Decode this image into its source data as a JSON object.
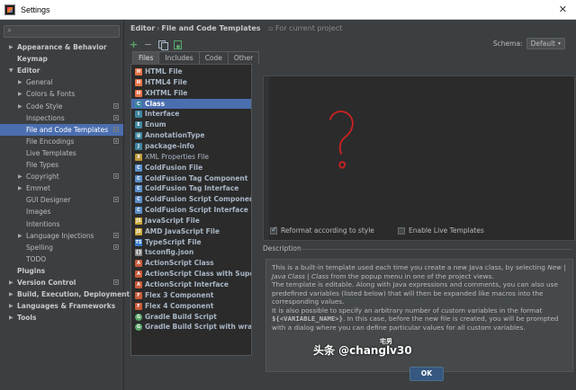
{
  "window": {
    "title": "Settings",
    "close_glyph": "✕"
  },
  "sidebar": {
    "search_placeholder": "",
    "items": [
      {
        "label": "Appearance & Behavior",
        "level": 0,
        "bold": true,
        "arrow": "▶",
        "project": false,
        "selected": false
      },
      {
        "label": "Keymap",
        "level": 0,
        "bold": true,
        "arrow": "",
        "project": false,
        "selected": false
      },
      {
        "label": "Editor",
        "level": 0,
        "bold": true,
        "arrow": "▼",
        "project": false,
        "selected": false
      },
      {
        "label": "General",
        "level": 1,
        "bold": false,
        "arrow": "▶",
        "project": false,
        "selected": false
      },
      {
        "label": "Colors & Fonts",
        "level": 1,
        "bold": false,
        "arrow": "▶",
        "project": false,
        "selected": false
      },
      {
        "label": "Code Style",
        "level": 1,
        "bold": false,
        "arrow": "▶",
        "project": true,
        "selected": false
      },
      {
        "label": "Inspections",
        "level": 1,
        "bold": false,
        "arrow": "",
        "project": true,
        "selected": false
      },
      {
        "label": "File and Code Templates",
        "level": 1,
        "bold": false,
        "arrow": "",
        "project": true,
        "selected": true
      },
      {
        "label": "File Encodings",
        "level": 1,
        "bold": false,
        "arrow": "",
        "project": true,
        "selected": false
      },
      {
        "label": "Live Templates",
        "level": 1,
        "bold": false,
        "arrow": "",
        "project": false,
        "selected": false
      },
      {
        "label": "File Types",
        "level": 1,
        "bold": false,
        "arrow": "",
        "project": false,
        "selected": false
      },
      {
        "label": "Copyright",
        "level": 1,
        "bold": false,
        "arrow": "▶",
        "project": true,
        "selected": false
      },
      {
        "label": "Emmet",
        "level": 1,
        "bold": false,
        "arrow": "▶",
        "project": false,
        "selected": false
      },
      {
        "label": "GUI Designer",
        "level": 1,
        "bold": false,
        "arrow": "",
        "project": true,
        "selected": false
      },
      {
        "label": "Images",
        "level": 1,
        "bold": false,
        "arrow": "",
        "project": false,
        "selected": false
      },
      {
        "label": "Intentions",
        "level": 1,
        "bold": false,
        "arrow": "",
        "project": false,
        "selected": false
      },
      {
        "label": "Language Injections",
        "level": 1,
        "bold": false,
        "arrow": "▶",
        "project": true,
        "selected": false
      },
      {
        "label": "Spelling",
        "level": 1,
        "bold": false,
        "arrow": "",
        "project": true,
        "selected": false
      },
      {
        "label": "TODO",
        "level": 1,
        "bold": false,
        "arrow": "",
        "project": false,
        "selected": false
      },
      {
        "label": "Plugins",
        "level": 0,
        "bold": true,
        "arrow": "",
        "project": false,
        "selected": false
      },
      {
        "label": "Version Control",
        "level": 0,
        "bold": true,
        "arrow": "▶",
        "project": true,
        "selected": false
      },
      {
        "label": "Build, Execution, Deployment",
        "level": 0,
        "bold": true,
        "arrow": "▶",
        "project": false,
        "selected": false
      },
      {
        "label": "Languages & Frameworks",
        "level": 0,
        "bold": true,
        "arrow": "▶",
        "project": false,
        "selected": false
      },
      {
        "label": "Tools",
        "level": 0,
        "bold": true,
        "arrow": "▶",
        "project": false,
        "selected": false
      }
    ]
  },
  "header": {
    "crumb_1": "Editor",
    "separator": "›",
    "crumb_2": "File and Code Templates",
    "scope_note": "For current project"
  },
  "toolbar": {
    "add": "+",
    "remove": "−"
  },
  "schema": {
    "label": "Schema:",
    "value": "Default",
    "chevron": "▾"
  },
  "tabs": [
    {
      "label": "Files",
      "active": true
    },
    {
      "label": "Includes",
      "active": false
    },
    {
      "label": "Code",
      "active": false
    },
    {
      "label": "Other",
      "active": false
    }
  ],
  "templates": [
    {
      "name": "HTML File",
      "icon": "html",
      "color": "#e8754a",
      "bold": true
    },
    {
      "name": "HTML4 File",
      "icon": "html",
      "color": "#e8754a",
      "bold": true
    },
    {
      "name": "XHTML File",
      "icon": "html",
      "color": "#e8754a",
      "bold": true
    },
    {
      "name": "Class",
      "icon": "class",
      "color": "#3e86a0",
      "bold": true,
      "selected": true
    },
    {
      "name": "Interface",
      "icon": "interface",
      "color": "#3e86a0",
      "bold": true
    },
    {
      "name": "Enum",
      "icon": "enum",
      "color": "#3e86a0",
      "bold": true
    },
    {
      "name": "AnnotationType",
      "icon": "annotation",
      "color": "#3e86a0",
      "bold": true
    },
    {
      "name": "package-info",
      "icon": "java",
      "color": "#3e86a0",
      "bold": true
    },
    {
      "name": "XML Properties File",
      "icon": "xml",
      "color": "#c09a3a",
      "bold": false
    },
    {
      "name": "ColdFusion File",
      "icon": "cf",
      "color": "#5c8fc9",
      "bold": true
    },
    {
      "name": "ColdFusion Tag Component",
      "icon": "cf",
      "color": "#5c8fc9",
      "bold": true
    },
    {
      "name": "ColdFusion Tag Interface",
      "icon": "cf",
      "color": "#5c8fc9",
      "bold": true
    },
    {
      "name": "ColdFusion Script Component",
      "icon": "cf",
      "color": "#5c8fc9",
      "bold": true
    },
    {
      "name": "ColdFusion Script Interface",
      "icon": "cf",
      "color": "#5c8fc9",
      "bold": true
    },
    {
      "name": "JavaScript File",
      "icon": "js",
      "color": "#c9a83a",
      "bold": true
    },
    {
      "name": "AMD JavaScript File",
      "icon": "js",
      "color": "#c9a83a",
      "bold": true
    },
    {
      "name": "TypeScript File",
      "icon": "ts",
      "color": "#3a7bc9",
      "bold": true
    },
    {
      "name": "tsconfig.json",
      "icon": "json",
      "color": "#8a8a8a",
      "bold": true
    },
    {
      "name": "ActionScript Class",
      "icon": "as",
      "color": "#c95a3a",
      "bold": true
    },
    {
      "name": "ActionScript Class with Supers",
      "icon": "as",
      "color": "#c95a3a",
      "bold": true
    },
    {
      "name": "ActionScript Interface",
      "icon": "as",
      "color": "#c95a3a",
      "bold": true
    },
    {
      "name": "Flex 3 Component",
      "icon": "flex",
      "color": "#c95a3a",
      "bold": true
    },
    {
      "name": "Flex 4 Component",
      "icon": "flex",
      "color": "#c95a3a",
      "bold": true
    },
    {
      "name": "Gradle Build Script",
      "icon": "gradle",
      "color": "#59a869",
      "bold": true
    },
    {
      "name": "Gradle Build Script with wrapper",
      "icon": "gradle",
      "color": "#59a869",
      "bold": true
    }
  ],
  "options": {
    "reformat_label": "Reformat according to style",
    "reformat_checked": true,
    "live_templates_label": "Enable Live Templates",
    "live_templates_checked": false
  },
  "description": {
    "label": "Description",
    "p1_a": "This is a built-in template used each time you create a new Java class, by selecting ",
    "p1_em": "New | Java Class | Class",
    "p1_b": " from the popup menu in one of the project views.",
    "p2": "The template is editable. Along with Java expressions and comments, you can also use predefined variables (listed below) that will then be expanded like macros into the corresponding values.",
    "p3_a": "It is also possible to specify an arbitrary number of custom variables in the format ",
    "p3_code": "${<VARIABLE_NAME>}",
    "p3_b": ". In this case, before the new file is created, you will be prompted with a dialog where you can define particular values for all custom variables."
  },
  "buttons": {
    "ok": "OK"
  },
  "watermark": {
    "text": "头条 @changlv30",
    "sub": "宅男"
  },
  "colors": {
    "accent": "#4b6eaf",
    "background": "#3c3f41",
    "editor_bg": "#2b2b2b",
    "annotation": "#cc2222"
  }
}
